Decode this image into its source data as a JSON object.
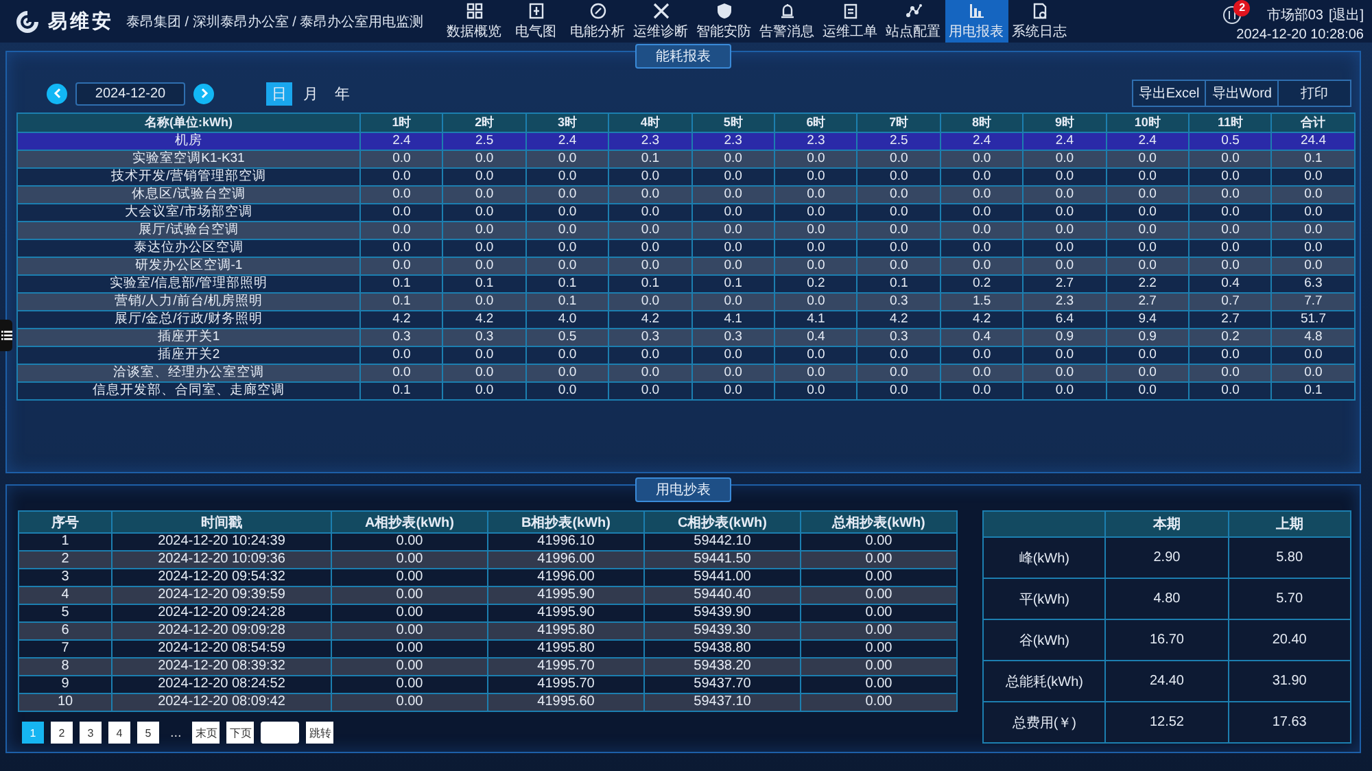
{
  "header": {
    "logo": "易维安",
    "breadcrumb": "泰昂集团 / 深圳泰昂办公室 / 泰昂办公室用电监测",
    "nav": [
      {
        "label": "数据概览",
        "selected": false
      },
      {
        "label": "电气图",
        "selected": false
      },
      {
        "label": "电能分析",
        "selected": false
      },
      {
        "label": "运维诊断",
        "selected": false
      },
      {
        "label": "智能安防",
        "selected": false
      },
      {
        "label": "告警消息",
        "selected": false
      },
      {
        "label": "运维工单",
        "selected": false
      },
      {
        "label": "站点配置",
        "selected": false
      },
      {
        "label": "用电报表",
        "selected": true
      },
      {
        "label": "系统日志",
        "selected": false
      }
    ],
    "alert_count": "2",
    "user": "市场部03",
    "logout": "[退出]",
    "datetime": "2024-12-20 10:28:06"
  },
  "energy_report": {
    "title": "能耗报表",
    "date": "2024-12-20",
    "periods": [
      {
        "label": "日",
        "selected": true
      },
      {
        "label": "月",
        "selected": false
      },
      {
        "label": "年",
        "selected": false
      }
    ],
    "actions": [
      "导出Excel",
      "导出Word",
      "打印"
    ],
    "columns": [
      "名称(单位:kWh)",
      "1时",
      "2时",
      "3时",
      "4时",
      "5时",
      "6时",
      "7时",
      "8时",
      "9时",
      "10时",
      "11时",
      "合计"
    ],
    "rows": [
      {
        "name": "机房",
        "selected": true,
        "values": [
          "2.4",
          "2.5",
          "2.4",
          "2.3",
          "2.3",
          "2.3",
          "2.5",
          "2.4",
          "2.4",
          "2.4",
          "0.5",
          "24.4"
        ]
      },
      {
        "name": "实验室空调K1-K31",
        "selected": false,
        "values": [
          "0.0",
          "0.0",
          "0.0",
          "0.1",
          "0.0",
          "0.0",
          "0.0",
          "0.0",
          "0.0",
          "0.0",
          "0.0",
          "0.1"
        ]
      },
      {
        "name": "技术开发/营销管理部空调",
        "selected": false,
        "values": [
          "0.0",
          "0.0",
          "0.0",
          "0.0",
          "0.0",
          "0.0",
          "0.0",
          "0.0",
          "0.0",
          "0.0",
          "0.0",
          "0.0"
        ]
      },
      {
        "name": "休息区/试验台空调",
        "selected": false,
        "values": [
          "0.0",
          "0.0",
          "0.0",
          "0.0",
          "0.0",
          "0.0",
          "0.0",
          "0.0",
          "0.0",
          "0.0",
          "0.0",
          "0.0"
        ]
      },
      {
        "name": "大会议室/市场部空调",
        "selected": false,
        "values": [
          "0.0",
          "0.0",
          "0.0",
          "0.0",
          "0.0",
          "0.0",
          "0.0",
          "0.0",
          "0.0",
          "0.0",
          "0.0",
          "0.0"
        ]
      },
      {
        "name": "展厅/试验台空调",
        "selected": false,
        "values": [
          "0.0",
          "0.0",
          "0.0",
          "0.0",
          "0.0",
          "0.0",
          "0.0",
          "0.0",
          "0.0",
          "0.0",
          "0.0",
          "0.0"
        ]
      },
      {
        "name": "泰达位办公区空调",
        "selected": false,
        "values": [
          "0.0",
          "0.0",
          "0.0",
          "0.0",
          "0.0",
          "0.0",
          "0.0",
          "0.0",
          "0.0",
          "0.0",
          "0.0",
          "0.0"
        ]
      },
      {
        "name": "研发办公区空调-1",
        "selected": false,
        "values": [
          "0.0",
          "0.0",
          "0.0",
          "0.0",
          "0.0",
          "0.0",
          "0.0",
          "0.0",
          "0.0",
          "0.0",
          "0.0",
          "0.0"
        ]
      },
      {
        "name": "实验室/信息部/管理部照明",
        "selected": false,
        "values": [
          "0.1",
          "0.1",
          "0.1",
          "0.1",
          "0.1",
          "0.2",
          "0.1",
          "0.2",
          "2.7",
          "2.2",
          "0.4",
          "6.3"
        ]
      },
      {
        "name": "营销/人力/前台/机房照明",
        "selected": false,
        "values": [
          "0.1",
          "0.0",
          "0.1",
          "0.0",
          "0.0",
          "0.0",
          "0.3",
          "1.5",
          "2.3",
          "2.7",
          "0.7",
          "7.7"
        ]
      },
      {
        "name": "展厅/金总/行政/财务照明",
        "selected": false,
        "values": [
          "4.2",
          "4.2",
          "4.0",
          "4.2",
          "4.1",
          "4.1",
          "4.2",
          "4.2",
          "6.4",
          "9.4",
          "2.7",
          "51.7"
        ]
      },
      {
        "name": "插座开关1",
        "selected": false,
        "values": [
          "0.3",
          "0.3",
          "0.5",
          "0.3",
          "0.3",
          "0.4",
          "0.3",
          "0.4",
          "0.9",
          "0.9",
          "0.2",
          "4.8"
        ]
      },
      {
        "name": "插座开关2",
        "selected": false,
        "values": [
          "0.0",
          "0.0",
          "0.0",
          "0.0",
          "0.0",
          "0.0",
          "0.0",
          "0.0",
          "0.0",
          "0.0",
          "0.0",
          "0.0"
        ]
      },
      {
        "name": "洽谈室、经理办公室空调",
        "selected": false,
        "values": [
          "0.0",
          "0.0",
          "0.0",
          "0.0",
          "0.0",
          "0.0",
          "0.0",
          "0.0",
          "0.0",
          "0.0",
          "0.0",
          "0.0"
        ]
      },
      {
        "name": "信息开发部、合同室、走廊空调",
        "selected": false,
        "values": [
          "0.1",
          "0.0",
          "0.0",
          "0.0",
          "0.0",
          "0.0",
          "0.0",
          "0.0",
          "0.0",
          "0.0",
          "0.0",
          "0.1"
        ]
      }
    ]
  },
  "meter_reading": {
    "title": "用电抄表",
    "columns": [
      "序号",
      "时间戳",
      "A相抄表(kWh)",
      "B相抄表(kWh)",
      "C相抄表(kWh)",
      "总相抄表(kWh)"
    ],
    "rows": [
      [
        "1",
        "2024-12-20 10:24:39",
        "0.00",
        "41996.10",
        "59442.10",
        "0.00"
      ],
      [
        "2",
        "2024-12-20 10:09:36",
        "0.00",
        "41996.00",
        "59441.50",
        "0.00"
      ],
      [
        "3",
        "2024-12-20 09:54:32",
        "0.00",
        "41996.00",
        "59441.00",
        "0.00"
      ],
      [
        "4",
        "2024-12-20 09:39:59",
        "0.00",
        "41995.90",
        "59440.40",
        "0.00"
      ],
      [
        "5",
        "2024-12-20 09:24:28",
        "0.00",
        "41995.90",
        "59439.90",
        "0.00"
      ],
      [
        "6",
        "2024-12-20 09:09:28",
        "0.00",
        "41995.80",
        "59439.30",
        "0.00"
      ],
      [
        "7",
        "2024-12-20 08:54:59",
        "0.00",
        "41995.80",
        "59438.80",
        "0.00"
      ],
      [
        "8",
        "2024-12-20 08:39:32",
        "0.00",
        "41995.70",
        "59438.20",
        "0.00"
      ],
      [
        "9",
        "2024-12-20 08:24:52",
        "0.00",
        "41995.70",
        "59437.70",
        "0.00"
      ],
      [
        "10",
        "2024-12-20 08:09:42",
        "0.00",
        "41995.60",
        "59437.10",
        "0.00"
      ]
    ],
    "pages": [
      {
        "label": "1",
        "selected": true
      },
      {
        "label": "2",
        "selected": false
      },
      {
        "label": "3",
        "selected": false
      },
      {
        "label": "4",
        "selected": false
      },
      {
        "label": "5",
        "selected": false
      }
    ],
    "ellipsis": "...",
    "last_page": "末页",
    "next_page": "下页",
    "jump": "跳转",
    "summary": {
      "columns": [
        "本期",
        "上期"
      ],
      "rows": [
        {
          "label": "峰(kWh)",
          "values": [
            "2.90",
            "5.80"
          ]
        },
        {
          "label": "平(kWh)",
          "values": [
            "4.80",
            "5.70"
          ]
        },
        {
          "label": "谷(kWh)",
          "values": [
            "16.70",
            "20.40"
          ]
        },
        {
          "label": "总能耗(kWh)",
          "values": [
            "24.40",
            "31.90"
          ]
        },
        {
          "label": "总费用(￥)",
          "values": [
            "12.52",
            "17.63"
          ]
        }
      ]
    }
  }
}
